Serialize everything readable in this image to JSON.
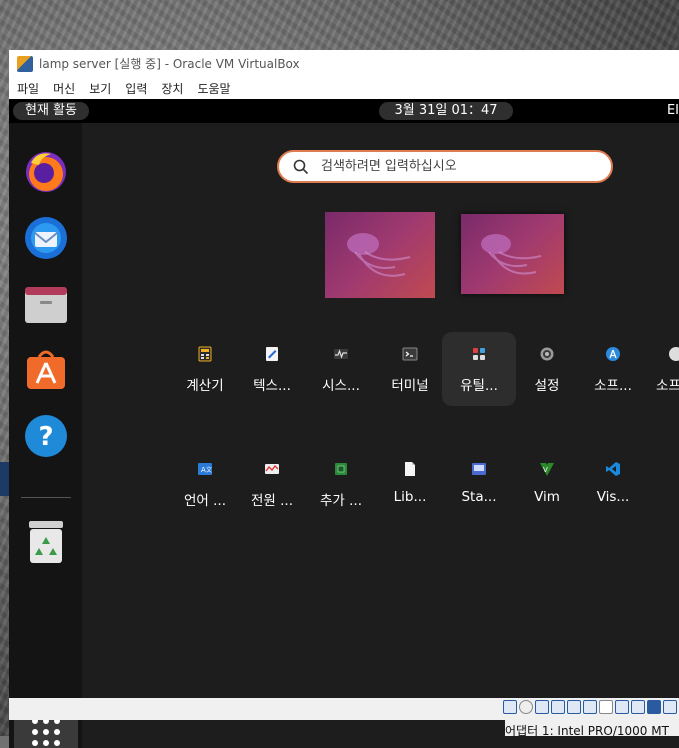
{
  "window": {
    "title": "lamp server [실행 중] - Oracle VM VirtualBox",
    "menu": [
      "파일",
      "머신",
      "보기",
      "입력",
      "장치",
      "도움말"
    ]
  },
  "topbar": {
    "activities": "현재 활동",
    "clock": "3월 31일  01：47",
    "right_label": "EI"
  },
  "search": {
    "placeholder": "검색하려면 입력하십시오",
    "value": ""
  },
  "dock": {
    "apps": [
      "firefox",
      "thunderbird",
      "files",
      "software",
      "help",
      "trash"
    ]
  },
  "apps": [
    {
      "label": "계산기",
      "icon": "calculator-icon"
    },
    {
      "label": "텍스...",
      "icon": "text-editor-icon"
    },
    {
      "label": "시스...",
      "icon": "system-monitor-icon"
    },
    {
      "label": "터미널",
      "icon": "terminal-icon"
    },
    {
      "label": "유틸...",
      "icon": "utilities-icon"
    },
    {
      "label": "설정",
      "icon": "settings-icon"
    },
    {
      "label": "소프...",
      "icon": "software-icon"
    },
    {
      "label": "소프",
      "icon": "software-updater-icon"
    },
    {
      "label": "언어 ...",
      "icon": "language-icon"
    },
    {
      "label": "전원 ...",
      "icon": "power-icon"
    },
    {
      "label": "추가 ...",
      "icon": "additional-drivers-icon"
    },
    {
      "label": "Lib...",
      "icon": "libreoffice-icon"
    },
    {
      "label": "Sta...",
      "icon": "startup-disk-icon"
    },
    {
      "label": "Vim",
      "icon": "vim-icon"
    },
    {
      "label": "Vis...",
      "icon": "vscode-icon"
    }
  ],
  "statusbar": {
    "adapter": "어댑터 1:  Intel PRO/1000 MT"
  }
}
